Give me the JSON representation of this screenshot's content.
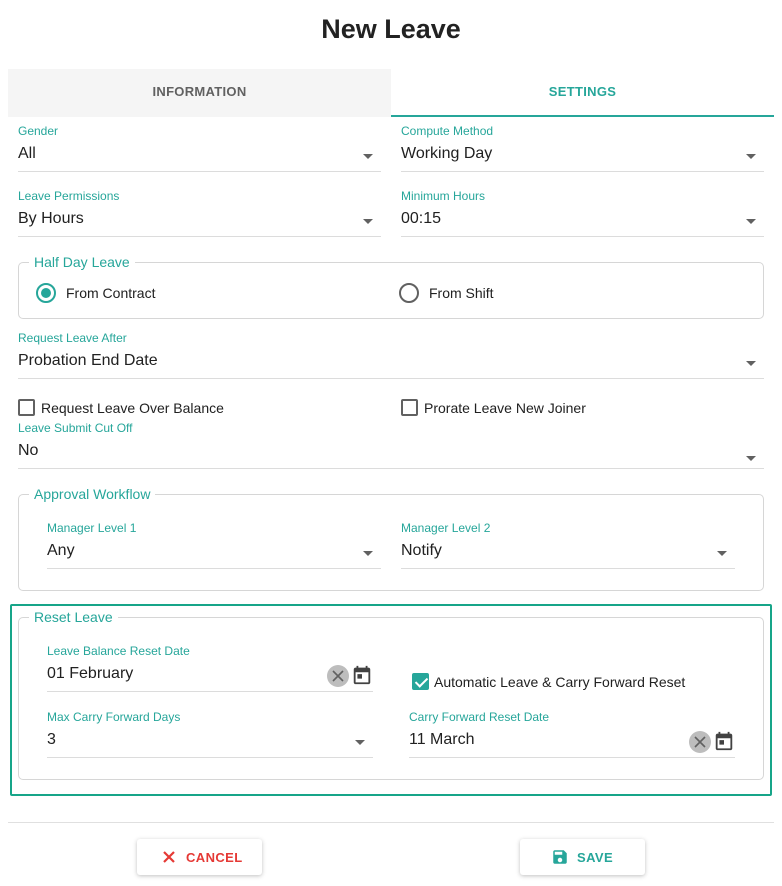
{
  "dialog": {
    "title": "New Leave"
  },
  "tabs": [
    {
      "label": "INFORMATION",
      "active": false
    },
    {
      "label": "SETTINGS",
      "active": true
    }
  ],
  "gender": {
    "label": "Gender",
    "value": "All"
  },
  "compute_method": {
    "label": "Compute Method",
    "value": "Working Day"
  },
  "leave_permissions": {
    "label": "Leave Permissions",
    "value": "By Hours"
  },
  "minimum_hours": {
    "label": "Minimum Hours",
    "value": "00:15"
  },
  "half_day_leave": {
    "legend": "Half Day Leave",
    "options": [
      {
        "label": "From Contract",
        "selected": true
      },
      {
        "label": "From Shift",
        "selected": false
      }
    ]
  },
  "request_leave_after": {
    "label": "Request Leave After",
    "value": "Probation End Date"
  },
  "checkboxes": {
    "request_over_balance": {
      "label": "Request Leave Over Balance",
      "checked": false
    },
    "prorate_new_joiner": {
      "label": "Prorate Leave New Joiner",
      "checked": false
    }
  },
  "leave_submit_cut_off": {
    "label": "Leave Submit Cut Off",
    "value": "No"
  },
  "approval_workflow": {
    "legend": "Approval Workflow",
    "manager_level_1": {
      "label": "Manager Level 1",
      "value": "Any"
    },
    "manager_level_2": {
      "label": "Manager Level 2",
      "value": "Notify"
    }
  },
  "reset_leave": {
    "legend": "Reset Leave",
    "balance_reset_date": {
      "label": "Leave Balance Reset Date",
      "value": "01 February"
    },
    "automatic_reset": {
      "label": "Automatic Leave & Carry Forward Reset",
      "checked": true
    },
    "max_carry_forward_days": {
      "label": "Max Carry Forward Days",
      "value": "3"
    },
    "carry_forward_reset_date": {
      "label": "Carry Forward Reset Date",
      "value": "11 March"
    }
  },
  "footer": {
    "cancel_label": "CANCEL",
    "save_label": "SAVE"
  },
  "colors": {
    "accent": "#26a69a",
    "cancel": "#e53935",
    "highlight_border": "#17a589"
  }
}
